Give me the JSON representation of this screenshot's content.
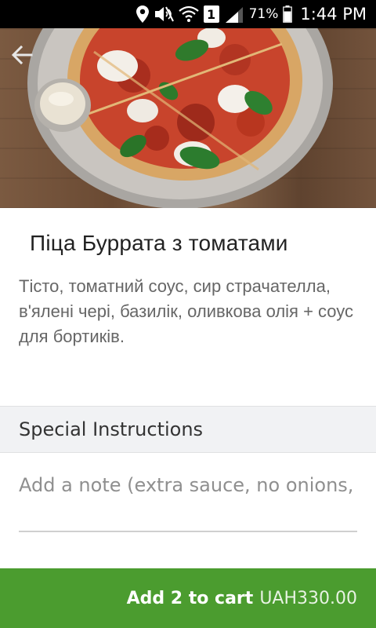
{
  "status_bar": {
    "sim_slot": "1",
    "battery": "71%",
    "time": "1:44 PM",
    "icons": [
      "location-icon",
      "mute-icon",
      "wifi-icon",
      "sim-icon",
      "signal-icon",
      "battery-icon"
    ]
  },
  "hero": {
    "image": "pizza-photo",
    "back_icon": "arrow-left-icon"
  },
  "product": {
    "title": "Піца Буррата з томатами",
    "description": "Тісто, томатний соус, сир страчателла, в'ялені чері, базилік, оливкова олія + соус для бортиків."
  },
  "special_instructions": {
    "header": "Special Instructions",
    "placeholder": "Add a note (extra sauce, no onions, etc.)",
    "value": ""
  },
  "cart": {
    "label": "Add 2 to cart",
    "price": "UAH330.00"
  },
  "colors": {
    "accent_green": "#4b9c2f",
    "status_bar": "#000000",
    "section_bg": "#f1f2f4"
  }
}
